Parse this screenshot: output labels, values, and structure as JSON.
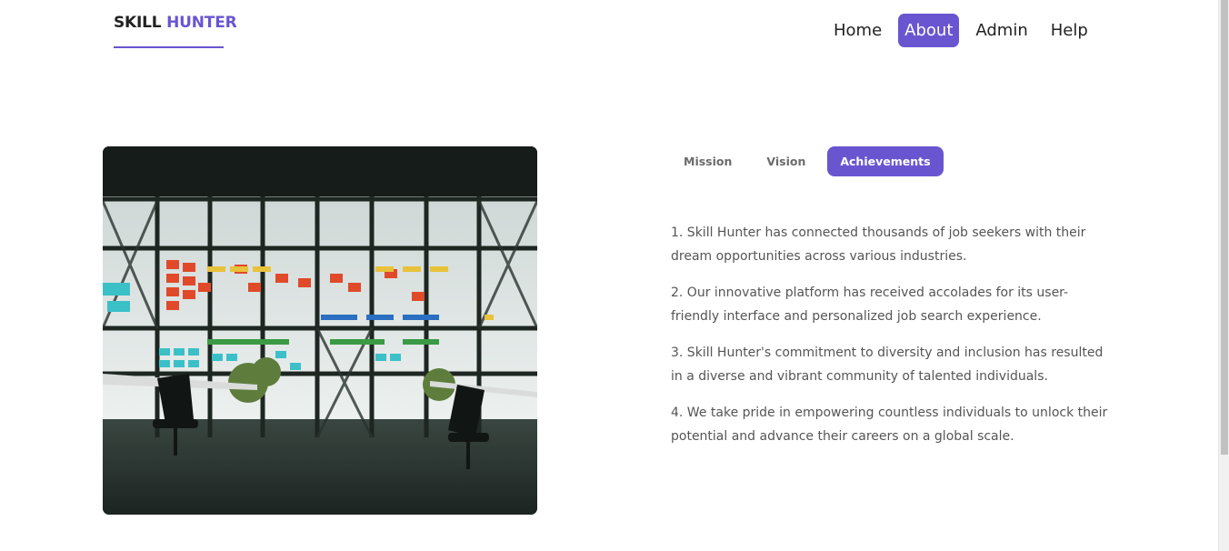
{
  "header": {
    "logo_part1": "SKILL",
    "logo_part2": "HUNTER",
    "nav": [
      "Home",
      "About",
      "Admin",
      "Help"
    ],
    "active_nav": "About"
  },
  "photo": {
    "description_icon": "office-photo"
  },
  "tabs": {
    "items": [
      "Mission",
      "Vision",
      "Achievements"
    ],
    "active": "Achievements"
  },
  "achievements": [
    "1. Skill Hunter has connected thousands of job seekers with their dream opportunities across various industries.",
    "2. Our innovative platform has received accolades for its user-friendly interface and personalized job search experience.",
    "3. Skill Hunter's commitment to diversity and inclusion has resulted in a diverse and vibrant community of talented individuals.",
    "4. We take pride in empowering countless individuals to unlock their potential and advance their careers on a global scale."
  ],
  "colors": {
    "accent": "#6a55d0",
    "text": "#555555",
    "heading": "#222222"
  }
}
